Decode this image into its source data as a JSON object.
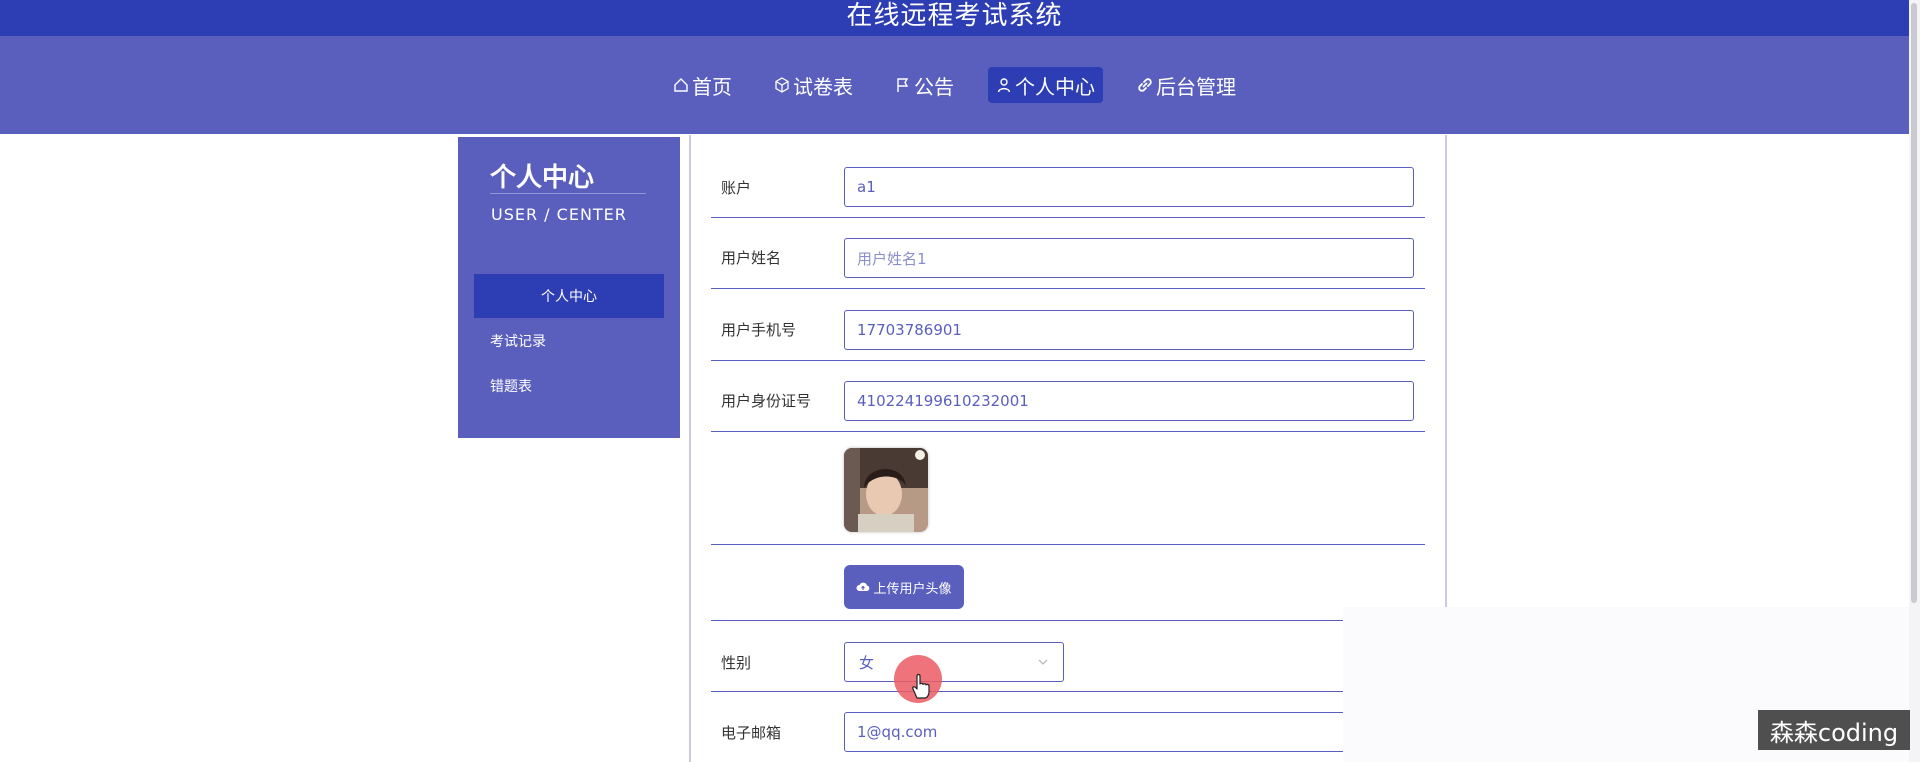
{
  "app": {
    "title": "在线远程考试系统"
  },
  "nav": {
    "items": [
      {
        "label": "首页",
        "icon": "home-icon",
        "active": false
      },
      {
        "label": "试卷表",
        "icon": "cube-icon",
        "active": false
      },
      {
        "label": "公告",
        "icon": "flag-icon",
        "active": false
      },
      {
        "label": "个人中心",
        "icon": "user-icon",
        "active": true
      },
      {
        "label": "后台管理",
        "icon": "link-icon",
        "active": false
      }
    ]
  },
  "sidebar": {
    "title": "个人中心",
    "subtitle": "USER / CENTER",
    "items": [
      {
        "label": "个人中心",
        "active": true
      },
      {
        "label": "考试记录",
        "active": false
      },
      {
        "label": "错题表",
        "active": false
      }
    ]
  },
  "form": {
    "account": {
      "label": "账户",
      "value": "a1"
    },
    "username": {
      "label": "用户姓名",
      "value": "用户姓名1"
    },
    "phone": {
      "label": "用户手机号",
      "value": "17703786901"
    },
    "id_card": {
      "label": "用户身份证号",
      "value": "410224199610232001"
    },
    "upload_label": "上传用户头像",
    "gender": {
      "label": "性别",
      "value": "女"
    },
    "email": {
      "label": "电子邮箱",
      "value": "1@qq.com"
    }
  },
  "watermark": "森森coding",
  "colors": {
    "primary": "#5a5fbd",
    "dark": "#2d3db3",
    "cursor": "#eb5a64"
  }
}
